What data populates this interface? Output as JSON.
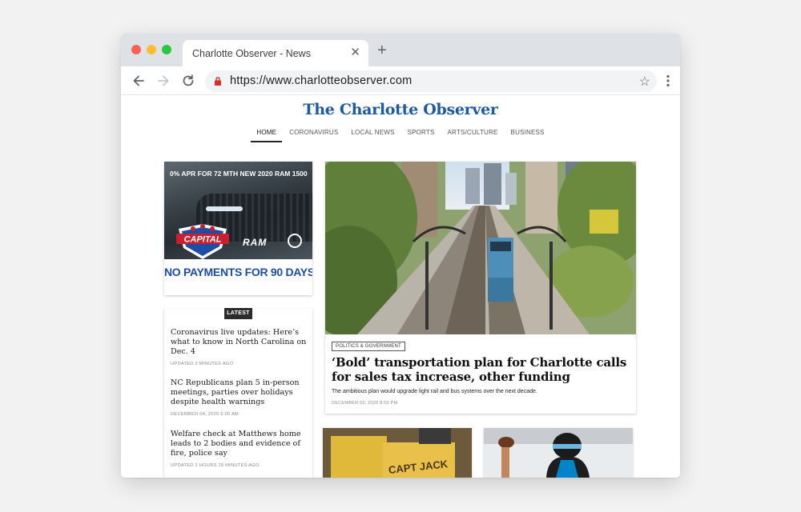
{
  "browser": {
    "tab_title": "Charlotte Observer - News",
    "url": "https://www.charlotteobserver.com"
  },
  "site": {
    "masthead": "The Charlotte Observer",
    "nav": [
      "HOME",
      "CORONAVIRUS",
      "LOCAL NEWS",
      "SPORTS",
      "ARTS/CULTURE",
      "BUSINESS"
    ],
    "active_nav": "HOME"
  },
  "ad": {
    "top_text": "0% APR FOR 72 MTH NEW 2020 RAM 1500",
    "brand": "CAPITAL",
    "sub_brand": "RAM",
    "bottom_text": "NO PAYMENTS FOR 90 DAYS"
  },
  "latest": {
    "badge": "LATEST",
    "stories": [
      {
        "title": "Coronavirus live updates: Here’s what to know in North Carolina on Dec. 4",
        "meta": "UPDATED 2 MINUTES AGO"
      },
      {
        "title": "NC Republicans plan 5 in-person meetings, parties over holidays despite health warnings",
        "meta": "DECEMBER 04, 2020 6:00 AM"
      },
      {
        "title": "Welfare check at Matthews home leads to 2 bodies and evidence of fire, police say",
        "meta": "UPDATED 2 HOURS 15 MINUTES AGO"
      }
    ]
  },
  "feature": {
    "tag": "POLITICS & GOVERNMENT",
    "headline": "‘Bold’ transportation plan for Charlotte calls for sales tax increase, other funding",
    "subhead": "The ambitious plan would upgrade light rail and bus systems over the next decade.",
    "date": "DECEMBER 03, 2020 8:50 PM"
  },
  "cards": {
    "left_sign": "CAPT JACK"
  },
  "colors": {
    "masthead_blue": "#1b5aa6",
    "ad_blue": "#1d4da6",
    "ad_red": "#c8202f"
  }
}
